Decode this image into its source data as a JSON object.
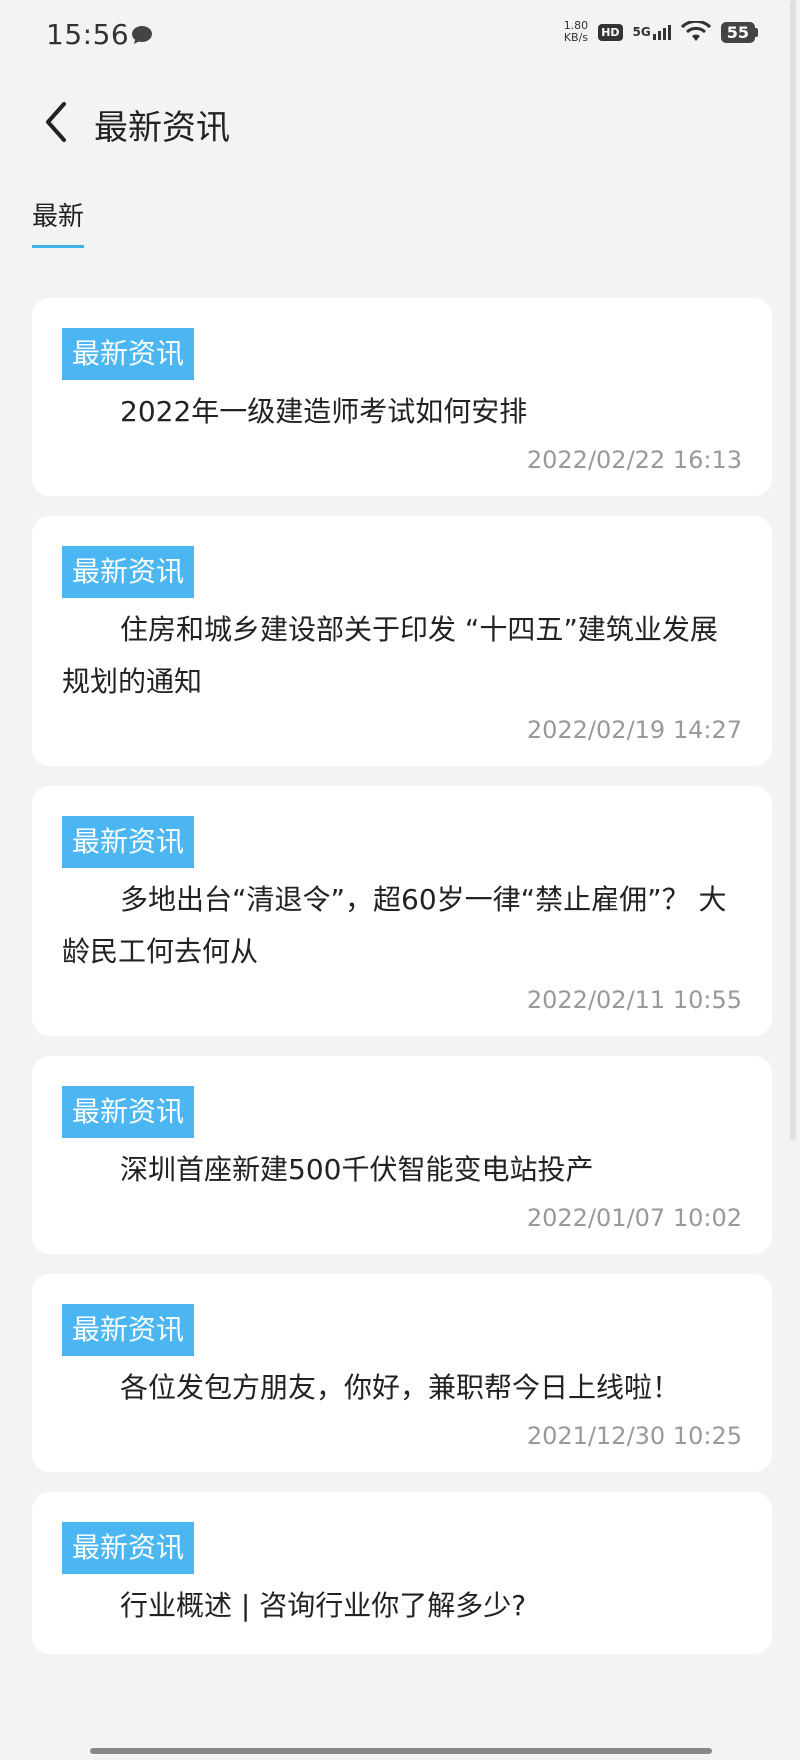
{
  "status": {
    "time": "15:56",
    "net_speed_value": "1.80",
    "net_speed_unit": "KB/s",
    "hd": "HD",
    "signal": "5G",
    "battery": "55"
  },
  "header": {
    "title": "最新资讯"
  },
  "tabs": [
    {
      "label": "最新"
    }
  ],
  "news": [
    {
      "badge": "最新资讯",
      "title": "2022年一级建造师考试如何安排",
      "date": "2022/02/22 16:13"
    },
    {
      "badge": "最新资讯",
      "title": "住房和城乡建设部关于印发 “十四五”建筑业发展规划的通知",
      "date": "2022/02/19 14:27"
    },
    {
      "badge": "最新资讯",
      "title": "多地出台“清退令”，超60岁一律“禁止雇佣”？ 大龄民工何去何从",
      "date": "2022/02/11 10:55"
    },
    {
      "badge": "最新资讯",
      "title": "深圳首座新建500千伏智能变电站投产",
      "date": "2022/01/07 10:02"
    },
    {
      "badge": "最新资讯",
      "title": "各位发包方朋友，你好，兼职帮今日上线啦！",
      "date": "2021/12/30 10:25"
    },
    {
      "badge": "最新资讯",
      "title": "行业概述 | 咨询行业你了解多少?",
      "date": ""
    }
  ],
  "colors": {
    "accent": "#4bb6f2",
    "tab_underline": "#3fb1e6",
    "background": "#f2f3f5"
  }
}
